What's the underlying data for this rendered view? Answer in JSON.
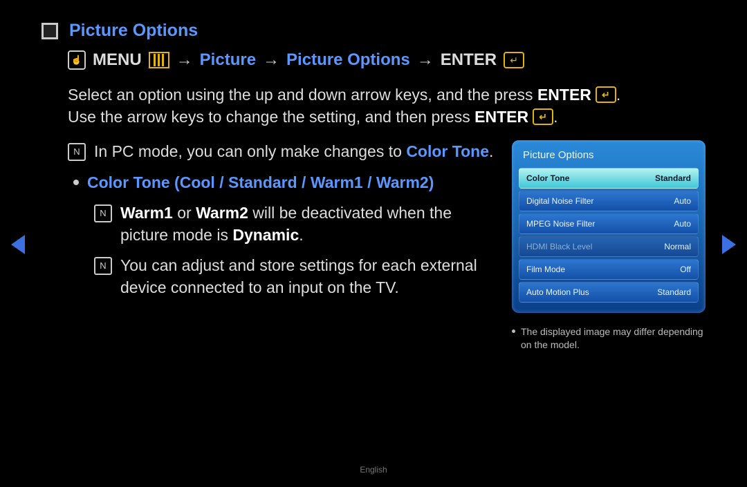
{
  "title": "Picture Options",
  "breadcrumb": {
    "menu_label": "MENU",
    "picture": "Picture",
    "picture_options": "Picture Options",
    "enter_label": "ENTER",
    "arrow": "→"
  },
  "description": {
    "line1_pre": "Select an option using the up and down arrow keys, and the press ",
    "line1_bold": "ENTER",
    "line1_post": ".",
    "line2_pre": "Use the arrow keys to change the setting, and then press ",
    "line2_bold": "ENTER",
    "line2_post": "."
  },
  "notes": {
    "pc_mode_pre": "In PC mode, you can only make changes to ",
    "pc_mode_highlight": "Color Tone",
    "pc_mode_post": "."
  },
  "bullet": {
    "label": "Color Tone (Cool / Standard / Warm1 / Warm2)"
  },
  "subnotes": {
    "warm_pre": "",
    "warm_bold1": "Warm1",
    "warm_mid1": " or ",
    "warm_bold2": "Warm2",
    "warm_mid2": " will be deactivated when the picture mode is ",
    "warm_bold3": "Dynamic",
    "warm_post": ".",
    "adjust": "You can adjust and store settings for each external device connected to an input on the TV."
  },
  "osd": {
    "title": "Picture Options",
    "items": [
      {
        "label": "Color Tone",
        "value": "Standard",
        "state": "highlight"
      },
      {
        "label": "Digital Noise Filter",
        "value": "Auto",
        "state": ""
      },
      {
        "label": "MPEG Noise Filter",
        "value": "Auto",
        "state": ""
      },
      {
        "label": "HDMI Black Level",
        "value": "Normal",
        "state": "disabled"
      },
      {
        "label": "Film Mode",
        "value": "Off",
        "state": ""
      },
      {
        "label": "Auto Motion Plus",
        "value": "Standard",
        "state": ""
      }
    ]
  },
  "panel_note": "The displayed image may differ depending on the model.",
  "footer": "English"
}
